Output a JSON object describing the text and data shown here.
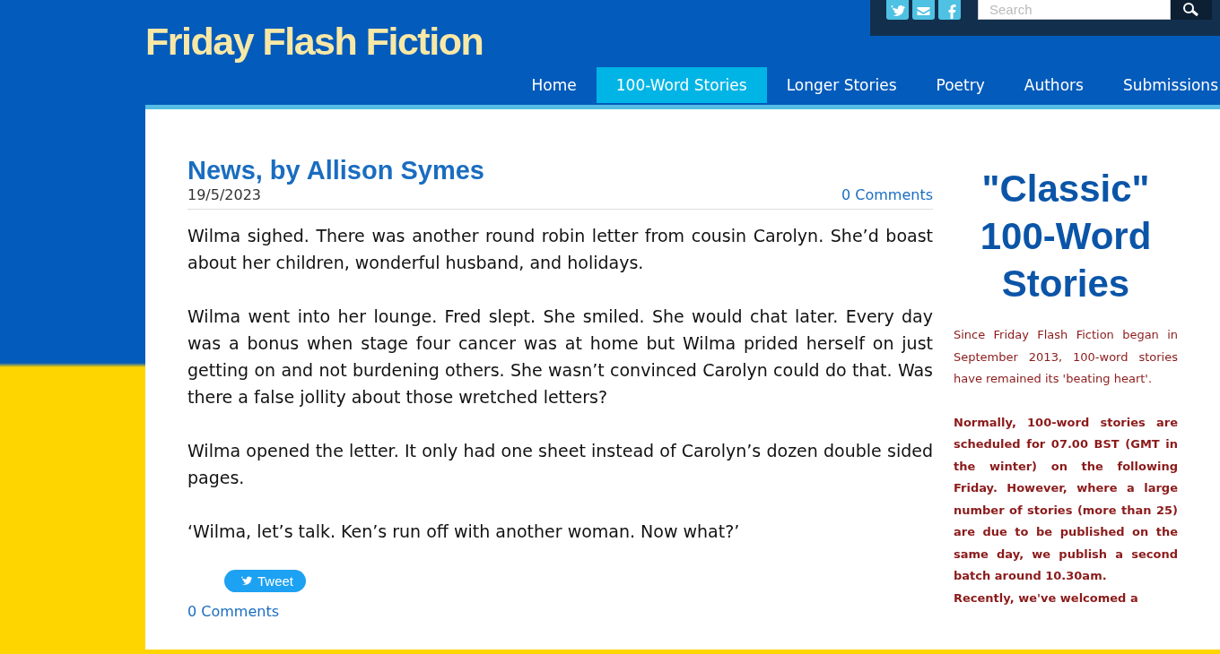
{
  "site_title": "Friday Flash Fiction",
  "social": [
    {
      "kind": "twitter"
    },
    {
      "kind": "email"
    },
    {
      "kind": "facebook"
    }
  ],
  "search": {
    "placeholder": "Search"
  },
  "nav": [
    {
      "label": "Home",
      "selected": false
    },
    {
      "label": "100-Word Stories",
      "selected": true
    },
    {
      "label": "Longer Stories",
      "selected": false
    },
    {
      "label": "Poetry",
      "selected": false
    },
    {
      "label": "Authors",
      "selected": false
    },
    {
      "label": "Submissions",
      "selected": false
    }
  ],
  "post": {
    "title": "News, by Allison Symes",
    "date": "19/5/2023",
    "comments_top": "0 Comments",
    "paragraphs": [
      "Wilma sighed. There was another round robin letter from cousin Carolyn. She’d boast about her children, wonderful husband, and holidays.",
      "Wilma went into her lounge. Fred slept. She smiled. She would chat later. Every day was a bonus when stage four cancer was at home but Wilma prided herself on just getting on and not burdening others. She wasn’t convinced Carolyn could do that. Was there a false jollity about those wretched letters?",
      "Wilma opened the letter. It only had one sheet instead of Carolyn’s dozen double sided pages.",
      "‘Wilma, let’s talk. Ken’s run off with another woman. Now what?’"
    ],
    "tweet": "Tweet",
    "comments_bottom": "0 Comments"
  },
  "sidebar": {
    "heading": "\"Classic\" 100-Word Stories",
    "paragraphs": [
      {
        "kind": "plain",
        "text": "Since Friday Flash Fiction began in September 2013, 100-word stories have remained its 'beating heart'."
      },
      {
        "kind": "bold",
        "text": "Normally, 100-word stories are scheduled for 07.00 BST (GMT in the winter) on the following Friday. However, where a large number of stories (more than 25) are due to be published on the same day, we publish a second batch around 10.30am."
      },
      {
        "kind": "bold",
        "text": "Recently, we've welcomed a"
      }
    ]
  }
}
